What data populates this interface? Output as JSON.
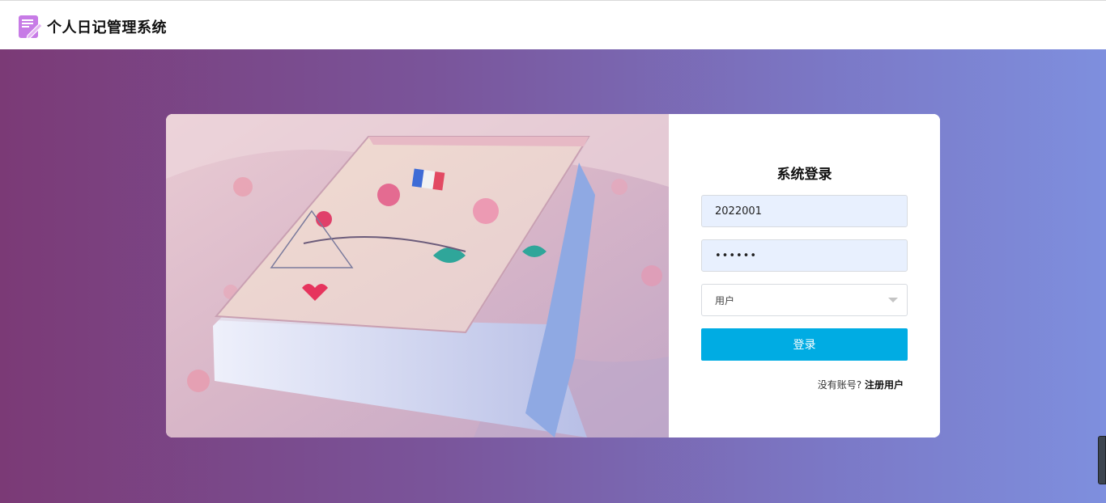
{
  "app": {
    "title": "个人日记管理系统",
    "icon": "notebook-pen-icon"
  },
  "login": {
    "title": "系统登录",
    "username_value": "2022001",
    "password_masked": "••••••",
    "role_selected": "用户",
    "submit_label": "登录",
    "no_account_text": "没有账号?",
    "register_label": "注册用户"
  },
  "colors": {
    "primary_button": "#00ace3",
    "gradient_start": "#7b3a76",
    "gradient_end": "#7e8fde",
    "input_autofill_bg": "#e8f0fe"
  }
}
